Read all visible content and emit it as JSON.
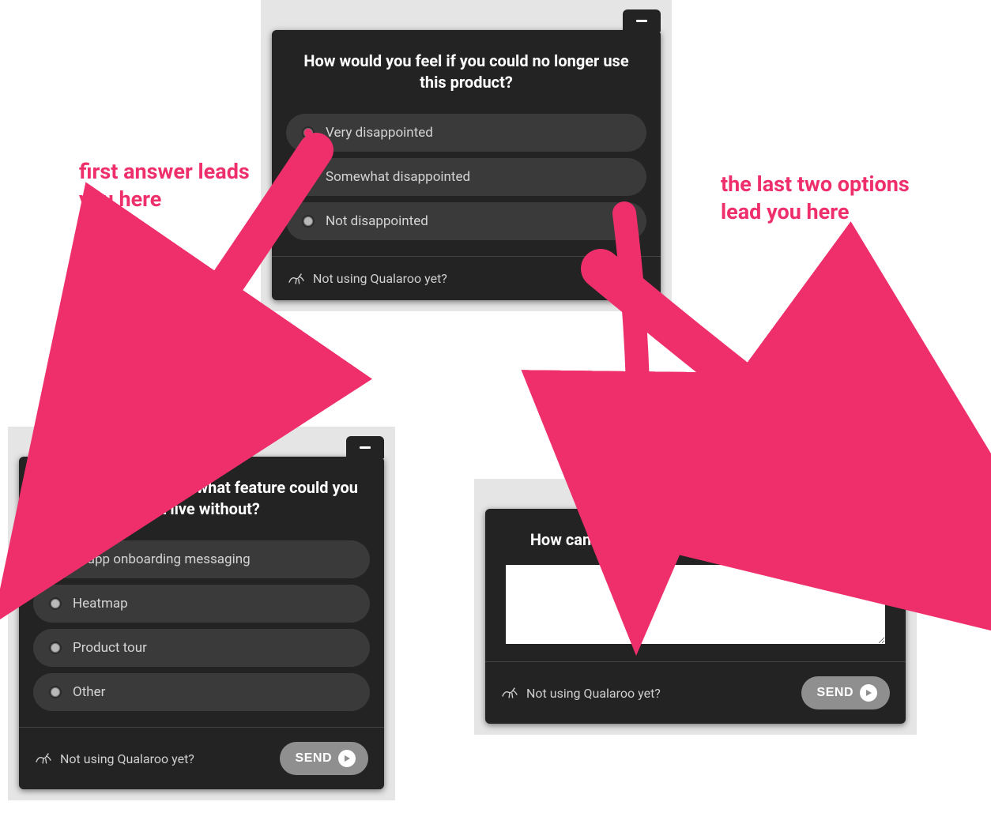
{
  "annotations": {
    "left": "first answer leads you here",
    "right": "the last two options lead you here"
  },
  "survey_top": {
    "question": "How would you feel if you could no longer use this product?",
    "options": [
      "Very disappointed",
      "Somewhat disappointed",
      "Not disappointed"
    ],
    "selected_index": 0,
    "promo": "Not using Qualaroo yet?"
  },
  "survey_left": {
    "question": "If you had to choose, what feature could you not live without?",
    "options": [
      "In-app onboarding messaging",
      "Heatmap",
      "Product tour",
      "Other"
    ],
    "promo": "Not using Qualaroo yet?",
    "send_label": "SEND"
  },
  "survey_right": {
    "question": "How can we improve your product experience?",
    "textarea_value": "",
    "promo": "Not using Qualaroo yet?",
    "send_label": "SEND"
  },
  "colors": {
    "accent_pink": "#ef2f6c",
    "panel_bg": "#232323"
  }
}
